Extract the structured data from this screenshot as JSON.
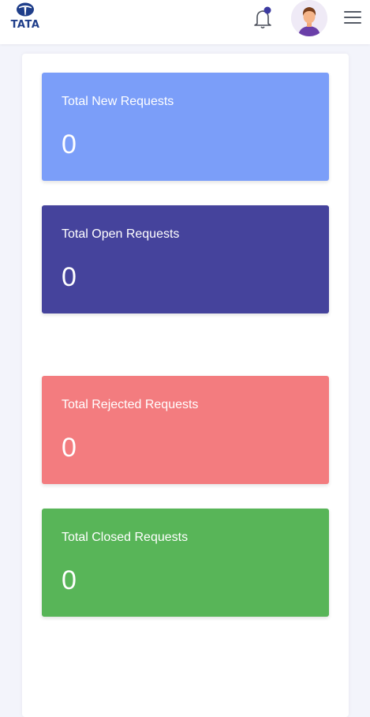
{
  "header": {
    "logo_text": "TATA",
    "notification_icon": "bell-icon",
    "avatar_icon": "user-avatar",
    "menu_icon": "hamburger-menu-icon"
  },
  "cards": [
    {
      "label": "Total New Requests",
      "value": "0",
      "color": "#7b9ef9"
    },
    {
      "label": "Total Open Requests",
      "value": "0",
      "color": "#45439c"
    },
    {
      "label": "Total Rejected Requests",
      "value": "0",
      "color": "#f37c7f"
    },
    {
      "label": "Total Closed Requests",
      "value": "0",
      "color": "#58b558"
    }
  ],
  "colors": {
    "brand": "#1f3e8a",
    "notification_dot": "#3c3aa0",
    "background": "#f3f4fb"
  }
}
